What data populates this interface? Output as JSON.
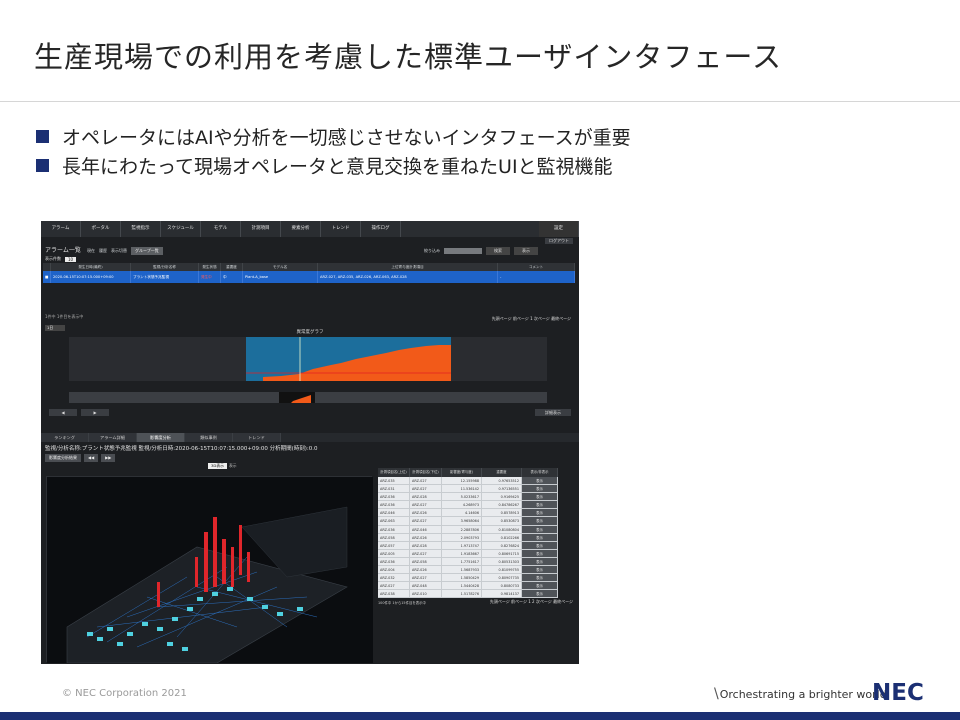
{
  "slide": {
    "title": "生産現場での利用を考慮した標準ユーザインタフェース",
    "bullets": [
      "オペレータにはAIや分析を一切感じさせないインタフェースが重要",
      "長年にわたって現場オペレータと意見交換を重ねたUIと監視機能"
    ]
  },
  "screen": {
    "nav_tabs": [
      "アラーム",
      "ポータル",
      "監視指示",
      "スケジュール",
      "モデル",
      "計測項目",
      "要素分析",
      "トレンド",
      "操作ログ"
    ],
    "nav_right": "設定",
    "logout": "ログアウト",
    "list_title": "アラーム一覧",
    "filter_labels": [
      "現在",
      "履歴",
      "表示切替"
    ],
    "filter_button": "グループ一覧",
    "search_label": "絞り込み",
    "search_buttons": [
      "検索",
      "表示"
    ],
    "count_label": "表示件数",
    "count_value": "10",
    "table_headers": [
      "",
      "発生日時(最終)",
      "監視/分析名称",
      "発生状態",
      "重要度",
      "モデル名",
      "上位寄与度計測項目",
      "コメント"
    ],
    "table_row": {
      "check": "■",
      "datetime": "2020-06-15T10:07:15.000+09:00",
      "name": "プラント状態予兆監視",
      "status": "発生中",
      "level": "中",
      "model": "Plant-A_base",
      "items": "ARZ-027, ARZ-035, ARZ-026, ARZ-063, ARZ-028",
      "comment": "-"
    },
    "chart_section_label": "1件中 1件目を表示中",
    "page_links": "先頭ページ 前ページ 1 次ページ 最終ページ",
    "range_select": "1日",
    "chart_title": "異常度グラフ",
    "nav_prev": "◀",
    "nav_next": "▶",
    "detail_button": "詳細表示",
    "sub_tabs": [
      "ランキング",
      "アラーム詳細",
      "影響度分析",
      "類似事例",
      "トレンド"
    ],
    "active_sub_tab": 2,
    "info_line": "監視/分析名称:プラント状態予兆監視  監視/分析日時:2020-06-15T10:07:15.000+09:00  分析期間(時刻):0.0",
    "action_buttons": [
      "影響度分析結果",
      "◀◀",
      "▶▶"
    ],
    "view_combo": [
      "3D表示",
      "表示"
    ],
    "data_headers": [
      "計測項目名(上位)",
      "計測項目名(下位)",
      "影響度(寄与度)",
      "重要度",
      "表示/非表示"
    ],
    "data_rows": [
      [
        "ARZ-035",
        "ARZ-027",
        "12.155988",
        "0.97653512",
        "表示"
      ],
      [
        "ARZ-031",
        "ARZ-027",
        "11.536142",
        "0.97136551",
        "表示"
      ],
      [
        "ARZ-036",
        "ARZ-028",
        "5.0233617",
        "0.9169425",
        "表示"
      ],
      [
        "ARZ-036",
        "ARZ-027",
        "4.268973",
        "0.84786267",
        "表示"
      ],
      [
        "ARZ-046",
        "ARZ-026",
        "4.14606",
        "0.8578913",
        "表示"
      ],
      [
        "ARZ-063",
        "ARZ-027",
        "3.9658064",
        "0.8530873",
        "表示"
      ],
      [
        "ARZ-036",
        "ARZ-046",
        "2.2887806",
        "0.81080804",
        "表示"
      ],
      [
        "ARZ-058",
        "ARZ-026",
        "2.0903793",
        "0.8102266",
        "表示"
      ],
      [
        "ARZ-057",
        "ARZ-028",
        "1.9713747",
        "0.8276824",
        "表示"
      ],
      [
        "ARZ-005",
        "ARZ-027",
        "1.9183667",
        "0.80691715",
        "表示"
      ],
      [
        "ARZ-036",
        "ARZ-058",
        "1.7751617",
        "0.80531303",
        "表示"
      ],
      [
        "ARZ-004",
        "ARZ-026",
        "1.5687933",
        "0.81099755",
        "表示"
      ],
      [
        "ARZ-032",
        "ARZ-027",
        "1.5850429",
        "0.80907735",
        "表示"
      ],
      [
        "ARZ-027",
        "ARZ-048",
        "1.5440428",
        "0.8080733",
        "表示"
      ],
      [
        "ARZ-038",
        "ARZ-010",
        "1.5178276",
        "0.9814137",
        "表示"
      ]
    ],
    "table_footer_left": "100件中 1から15件目を表示中",
    "table_footer_right": "先頭ページ 前ページ 1 2 次ページ 最終ページ",
    "chart_colors": {
      "background": "#1c6e9c",
      "bars": "#f25a19",
      "line": "#e02020"
    }
  },
  "footer": {
    "copyright": "© NEC Corporation 2021",
    "tagline": "Orchestrating a brighter world",
    "logo": "NEC"
  }
}
